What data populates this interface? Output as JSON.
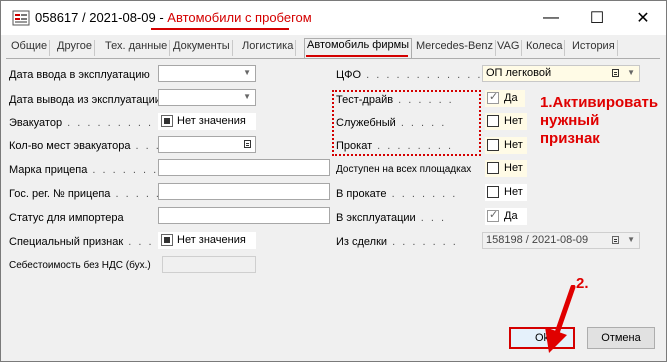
{
  "window": {
    "title_prefix": "058617 / 2021-08-09 - ",
    "title_highlight": "Автомобили с пробегом",
    "minimize": "—",
    "maximize": "☐",
    "close": "✕"
  },
  "tabs": [
    "Общие",
    "Другое",
    "Тех. данные",
    "Документы",
    "Логистика",
    "Автомобиль фирмы",
    "Mercedes-Benz",
    "VAG",
    "Колеса",
    "История"
  ],
  "active_tab": "Автомобиль фирмы",
  "left": {
    "date_in_label": "Дата ввода в эксплуатацию",
    "date_out_label": "Дата вывода из эксплуатации",
    "evacuator_label": "Эвакуатор",
    "evacuator_value": "Нет значения",
    "evac_seats_label": "Кол-во мест эвакуатора",
    "trailer_brand_label": "Марка прицепа",
    "trailer_reg_label": "Гос. рег. № прицепа",
    "importer_status_label": "Статус для импортера",
    "special_label": "Специальный признак",
    "special_value": "Нет значения",
    "cost_label": "Себестоимость без НДС (бух.)"
  },
  "right": {
    "cfo_label": "ЦФО",
    "cfo_value": "ОП легковой",
    "test_drive_label": "Тест-драйв",
    "test_drive_value": "Да",
    "service_label": "Служебный",
    "service_value": "Нет",
    "rental_label": "Прокат",
    "rental_value": "Нет",
    "all_sites_label": "Доступен на всех площадках",
    "all_sites_value": "Нет",
    "in_rental_label": "В прокате",
    "in_rental_value": "Нет",
    "in_operation_label": "В эксплуатации",
    "in_operation_value": "Да",
    "deal_label": "Из сделки",
    "deal_value": "158198 / 2021-08-09"
  },
  "annotations": {
    "step1_line1": "1.Активировать",
    "step1_line2": "нужный",
    "step1_line3": "признак",
    "step2": "2."
  },
  "buttons": {
    "ok": "Ok",
    "cancel": "Отмена"
  },
  "colors": {
    "annotation_red": "#e00000",
    "readonly_yellow": "#fffbe6"
  }
}
